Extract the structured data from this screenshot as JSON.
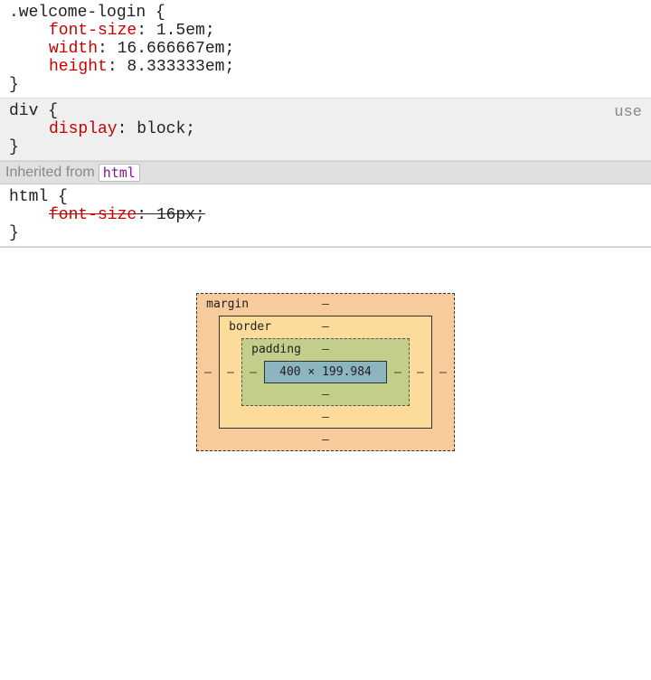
{
  "rules": [
    {
      "selector": ".welcome-login",
      "open_brace": " {",
      "declarations": [
        {
          "property": "font-size",
          "value": "1.5em",
          "strike": false
        },
        {
          "property": "width",
          "value": "16.666667em",
          "strike": false
        },
        {
          "property": "height",
          "value": "8.333333em",
          "strike": false
        }
      ],
      "close_brace": "}",
      "shaded": false,
      "right_text": ""
    },
    {
      "selector": "div",
      "open_brace": " {",
      "declarations": [
        {
          "property": "display",
          "value": "block",
          "strike": false
        }
      ],
      "close_brace": "}",
      "shaded": true,
      "right_text": "use"
    }
  ],
  "inherited": {
    "label": "Inherited from",
    "tag": "html"
  },
  "inherited_rule": {
    "selector": "html",
    "open_brace": " {",
    "declarations": [
      {
        "property": "font-size",
        "value": "16px",
        "strike": true
      }
    ],
    "close_brace": "}"
  },
  "boxmodel": {
    "margin": {
      "label": "margin",
      "top": "–",
      "right": "–",
      "bottom": "–",
      "left": "–"
    },
    "border": {
      "label": "border",
      "top": "–",
      "right": "–",
      "bottom": "–",
      "left": "–"
    },
    "padding": {
      "label": "padding",
      "top": "–",
      "right": "–",
      "bottom": "–",
      "left": "–"
    },
    "content": "400 × 199.984"
  },
  "punct": {
    "colon": ": ",
    "semicolon": ";"
  }
}
